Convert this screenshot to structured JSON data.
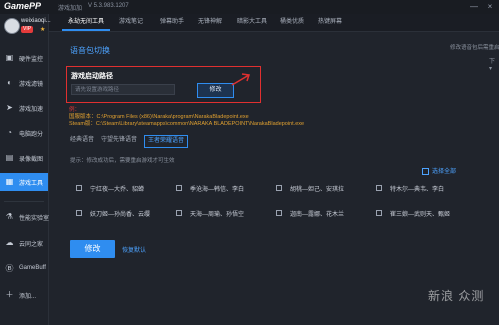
{
  "app": {
    "logo": "GamePP",
    "logo_sub": "游戏加加",
    "version": "V 5.3.983.1207",
    "window_controls": [
      "—",
      "×"
    ]
  },
  "profile": {
    "username": "weixiaoqi...",
    "vip_label": "VIP",
    "vip_icon": "★"
  },
  "sidebar": {
    "items": [
      {
        "label": "硬件监控",
        "icon": "monitor-icon",
        "glyph": "▣"
      },
      {
        "label": "游戏滤镜",
        "icon": "filter-icon",
        "glyph": "◐"
      },
      {
        "label": "游戏加速",
        "icon": "rocket-icon",
        "glyph": "➤"
      },
      {
        "label": "电脑跑分",
        "icon": "speedometer-icon",
        "glyph": "◔"
      },
      {
        "label": "录像截图",
        "icon": "camera-icon",
        "glyph": "▤"
      },
      {
        "label": "游戏工具",
        "icon": "tools-icon",
        "glyph": "▦",
        "active": true
      }
    ],
    "bottom_items": [
      {
        "label": "性能实验室",
        "icon": "lab-icon",
        "glyph": "⚗"
      },
      {
        "label": "云同之家",
        "icon": "cloud-icon",
        "glyph": "☁"
      },
      {
        "label": "GameBuff",
        "icon": "gamebuff-icon",
        "glyph": "Ⓑ"
      },
      {
        "label": "添加...",
        "icon": "add-icon",
        "glyph": "＋"
      }
    ]
  },
  "tabs": [
    "永劫无间工具",
    "游戏笔记",
    "弹幕助手",
    "无锋神解",
    "暗影大工具",
    "桶类优质",
    "热键屏幕"
  ],
  "main": {
    "section_title": "语音包切换",
    "hint_right": "修改语音包后需重启游戏生效",
    "hint_arrow": "下 ▾",
    "path": {
      "label": "游戏启动路径",
      "placeholder": "请先设置游戏路径",
      "modify_button": "修改"
    },
    "notes": {
      "head": "例：",
      "lines": [
        "国服版本：C:\\Program Files (x86)\\Naraka\\program\\NarakaBladepoint.exe",
        "Steam版：C:\\Steam\\Library\\steamapps\\common\\NARAKA BLADEPOINT\\NarakaBladepoint.exe"
      ]
    },
    "voice_tabs": [
      {
        "label": "经典语音",
        "active": false
      },
      {
        "label": "守望先锋语音",
        "active": false
      },
      {
        "label": "王者荣耀语音",
        "active": true
      }
    ],
    "tip": "提示：修改成功后，需要重启游戏才可生效",
    "select_all": "选择全部",
    "combos": [
      "宁红夜—大乔、貂蝉",
      "季沧海—韩信、李白",
      "胡桃—妲己、安琪拉",
      "特木尔—典韦、李白",
      "妖刀姬—孙尚香、云缨",
      "天海—周瑜、孙悟空",
      "迦南—露娜、花木兰",
      "崔三娘—武则天、甄姬"
    ],
    "apply_button": "修改",
    "restore_link": "恢复默认"
  },
  "watermark": "新浪 众测"
}
